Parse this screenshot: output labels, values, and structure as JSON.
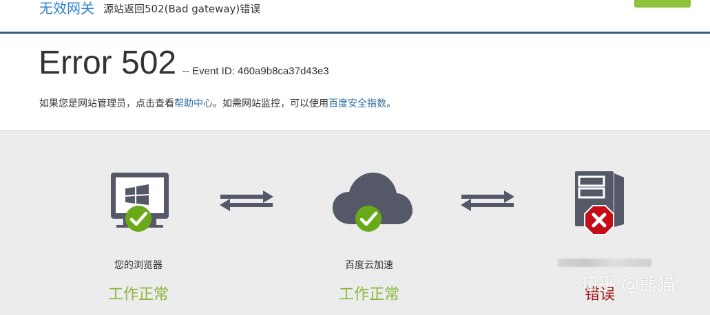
{
  "header": {
    "brand": "无效网关",
    "subtitle": "源站返回502(Bad gateway)错误",
    "action_button_color": "#8fc23c"
  },
  "error": {
    "title": "Error 502",
    "event_id": "-- Event ID: 460a9b8ca37d43e3",
    "hint_prefix": "如果您是网站管理员，点击查看",
    "help_link": "帮助中心",
    "hint_middle": "。如需网站监控，可以使用",
    "security_link": "百度安全指数",
    "hint_suffix": "。"
  },
  "nodes": [
    {
      "label": "您的浏览器",
      "status": "工作正常",
      "status_color": "#8ab73b",
      "icon": "computer-icon"
    },
    {
      "label": "百度云加速",
      "status": "工作正常",
      "status_color": "#8ab73b",
      "icon": "cloud-icon"
    },
    {
      "label": "",
      "status": "错误",
      "status_color": "#a31c1c",
      "icon": "server-icon"
    }
  ],
  "watermark": "知乎 @熊猫",
  "colors": {
    "header_border": "#345e85",
    "link": "#2f6fa8",
    "brand": "#2f84c7",
    "icon_dark": "#555867",
    "ok": "#6aaa18",
    "error": "#c40d17"
  }
}
